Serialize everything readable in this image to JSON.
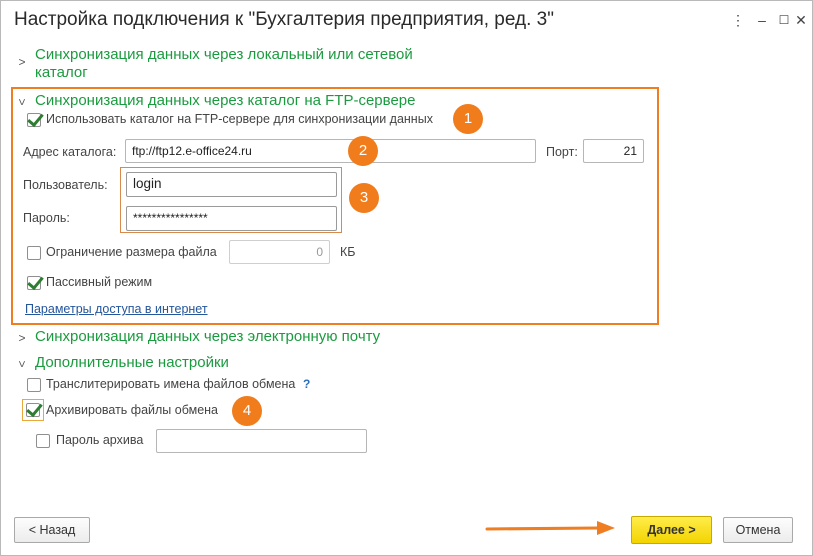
{
  "window": {
    "title": "Настройка подключения к \"Бухгалтерия предприятия, ред. 3\"",
    "more_icon": "⋮",
    "minimize_icon": "–",
    "maximize_icon": "☐",
    "close_icon": "✕"
  },
  "sections": {
    "local": {
      "title_line1": "Синхронизация данных через локальный или сетевой",
      "title_line2": "каталог"
    },
    "ftp": {
      "title": "Синхронизация данных через каталог на FTP-сервере"
    },
    "email": {
      "title": "Синхронизация данных через электронную почту"
    },
    "extra": {
      "title": "Дополнительные настройки"
    }
  },
  "ftp": {
    "use_ftp_label": "Использовать каталог на FTP-сервере для синхронизации данных",
    "use_ftp_checked": true,
    "address_label": "Адрес каталога:",
    "address_value": "ftp://ftp12.e-office24.ru",
    "port_label": "Порт:",
    "port_value": "21",
    "user_label": "Пользователь:",
    "user_value": "login",
    "password_label": "Пароль:",
    "password_value": "****************",
    "limit_label": "Ограничение размера файла",
    "limit_checked": false,
    "limit_value": "0",
    "limit_unit": "КБ",
    "passive_label": "Пассивный режим",
    "passive_checked": true,
    "internet_link": "Параметры доступа в интернет"
  },
  "extra": {
    "translit_label": "Транслитерировать имена файлов обмена",
    "translit_checked": false,
    "help_mark": "?",
    "archive_label": "Архивировать файлы обмена",
    "archive_checked": true,
    "archive_pwd_label": "Пароль архива",
    "archive_pwd_checked": false,
    "archive_pwd_value": ""
  },
  "badges": [
    "1",
    "2",
    "3",
    "4"
  ],
  "buttons": {
    "back": "< Назад",
    "next": "Далее >",
    "cancel": "Отмена"
  },
  "colors": {
    "section_title": "#1b9b3f",
    "highlight": "#ef7d22",
    "primary_button": "#f3d400",
    "link": "#24569b"
  }
}
